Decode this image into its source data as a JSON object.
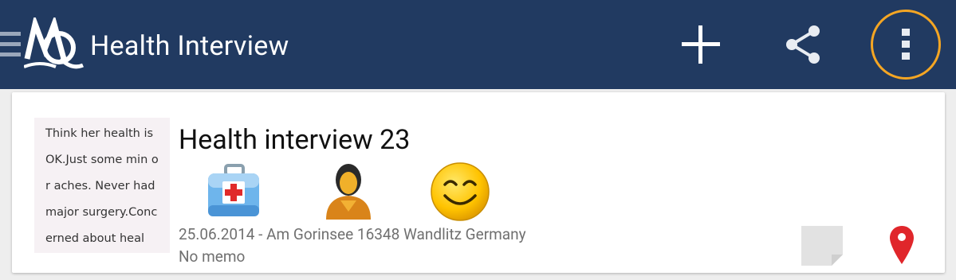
{
  "app_bar": {
    "title": "Health Interview",
    "colors": {
      "background": "#213a61",
      "overflow_highlight": "#f5a623"
    },
    "icons": [
      "menu-icon",
      "app-logo-icon",
      "add-icon",
      "share-icon",
      "more-vert-icon"
    ]
  },
  "entry": {
    "memo_preview": "Think her health is OK.Just some min or aches. Never had major surgery.Concerned about heal",
    "title": "Health interview 23",
    "icons": [
      "medical-kit-icon",
      "person-icon",
      "smiley-icon",
      "note-icon",
      "location-pin-icon"
    ],
    "meta": "25.06.2014 - Am Gorinsee 16348 Wandlitz Germany",
    "memo": "No memo",
    "colors": {
      "pin": "#e0262b",
      "note": "#e2e2e2"
    }
  }
}
